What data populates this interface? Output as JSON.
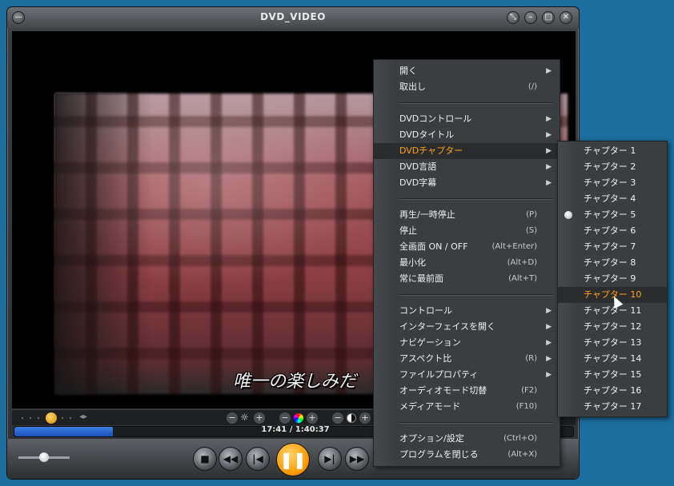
{
  "window": {
    "title": "DVD_VIDEO"
  },
  "video": {
    "subtitle": "唯一の楽しみだ"
  },
  "playback": {
    "time": "17:41 / 1:40:37",
    "progress_percent": 17.6
  },
  "menu": {
    "items": [
      {
        "label": "開く",
        "shortcut": "",
        "submenu": true
      },
      {
        "label": "取出し",
        "shortcut": "(/)",
        "submenu": false
      },
      {
        "label": "DVDコントロール",
        "shortcut": "",
        "submenu": true
      },
      {
        "label": "DVDタイトル",
        "shortcut": "",
        "submenu": true
      },
      {
        "label": "DVDチャプター",
        "shortcut": "",
        "submenu": true
      },
      {
        "label": "DVD言語",
        "shortcut": "",
        "submenu": true
      },
      {
        "label": "DVD字幕",
        "shortcut": "",
        "submenu": true
      },
      {
        "label": "再生/一時停止",
        "shortcut": "(P)",
        "submenu": false
      },
      {
        "label": "停止",
        "shortcut": "(S)",
        "submenu": false
      },
      {
        "label": "全画面 ON / OFF",
        "shortcut": "(Alt+Enter)",
        "submenu": false
      },
      {
        "label": "最小化",
        "shortcut": "(Alt+D)",
        "submenu": false
      },
      {
        "label": "常に最前面",
        "shortcut": "(Alt+T)",
        "submenu": false
      },
      {
        "label": "コントロール",
        "shortcut": "",
        "submenu": true
      },
      {
        "label": "インターフェイスを開く",
        "shortcut": "",
        "submenu": true
      },
      {
        "label": "ナビゲーション",
        "shortcut": "",
        "submenu": true
      },
      {
        "label": "アスペクト比",
        "shortcut": "(R)",
        "submenu": true
      },
      {
        "label": "ファイルプロパティ",
        "shortcut": "",
        "submenu": true
      },
      {
        "label": "オーディオモード切替",
        "shortcut": "(F2)",
        "submenu": false
      },
      {
        "label": "メディアモード",
        "shortcut": "(F10)",
        "submenu": false
      },
      {
        "label": "オプション/設定",
        "shortcut": "(Ctrl+O)",
        "submenu": false
      },
      {
        "label": "プログラムを閉じる",
        "shortcut": "(Alt+X)",
        "submenu": false
      }
    ],
    "highlighted_index": 4
  },
  "chapters": {
    "items": [
      "チャプター 1",
      "チャプター 2",
      "チャプター 3",
      "チャプター 4",
      "チャプター 5",
      "チャプター 6",
      "チャプター 7",
      "チャプター 8",
      "チャプター 9",
      "チャプター 10",
      "チャプター 11",
      "チャプター 12",
      "チャプター 13",
      "チャプター 14",
      "チャプター 15",
      "チャプター 16",
      "チャプター 17"
    ],
    "current_index": 4,
    "hovered_index": 9
  },
  "colors": {
    "highlight_text": "#ffa319",
    "seek_fill": "#2a64d0"
  }
}
